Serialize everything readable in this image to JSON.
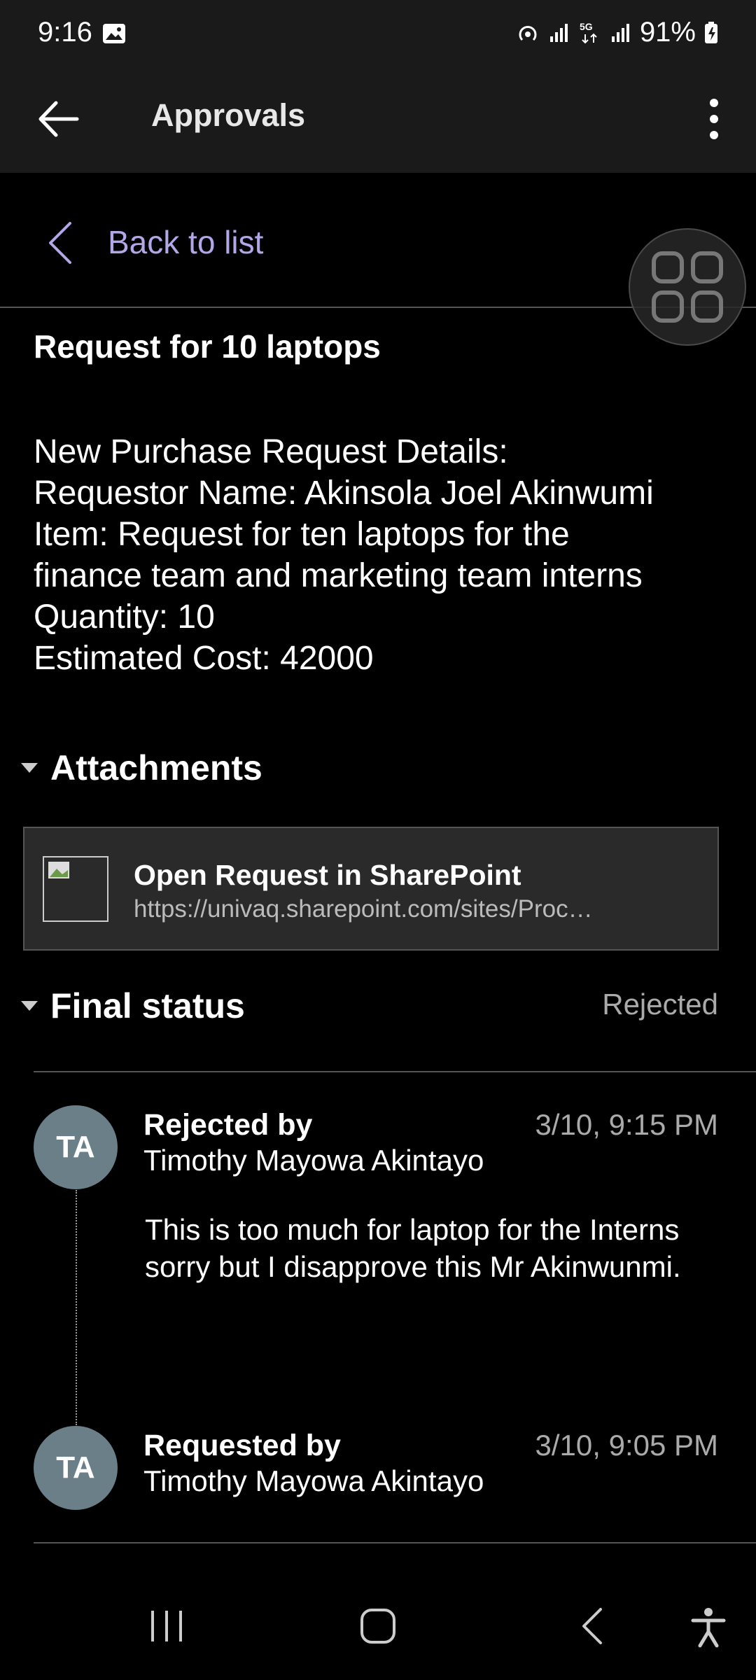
{
  "status_bar": {
    "time": "9:16",
    "battery": "91%",
    "icons": [
      "image-icon",
      "hotspot-icon",
      "signal-icon",
      "5g-icon",
      "signal-icon",
      "battery-icon"
    ]
  },
  "app_bar": {
    "title": "Approvals"
  },
  "back": {
    "label": "Back to list"
  },
  "request": {
    "title": "Request for 10 laptops",
    "details": [
      "New Purchase Request Details:",
      "Requestor Name:  Akinsola Joel Akinwumi",
      "Item: Request for ten laptops for the",
      "finance team and marketing team interns",
      "Quantity: 10",
      "Estimated Cost: 42000"
    ]
  },
  "attachments": {
    "heading": "Attachments",
    "items": [
      {
        "name": "Open Request in SharePoint",
        "url": "https://univaq.sharepoint.com/sites/Proc…"
      }
    ]
  },
  "final_status": {
    "heading": "Final status",
    "value": "Rejected",
    "entries": [
      {
        "initials": "TA",
        "label": "Rejected by",
        "name": "Timothy Mayowa Akintayo",
        "time": "3/10, 9:15 PM",
        "comment": "This is too much for laptop for the Interns sorry but I disapprove this Mr Akinwunmi."
      },
      {
        "initials": "TA",
        "label": "Requested by",
        "name": "Timothy Mayowa Akintayo",
        "time": "3/10, 9:05 PM"
      }
    ]
  },
  "colors": {
    "link": "#b3a7e8",
    "avatar": "#6b7f88",
    "bar": "#1a1a1a"
  }
}
